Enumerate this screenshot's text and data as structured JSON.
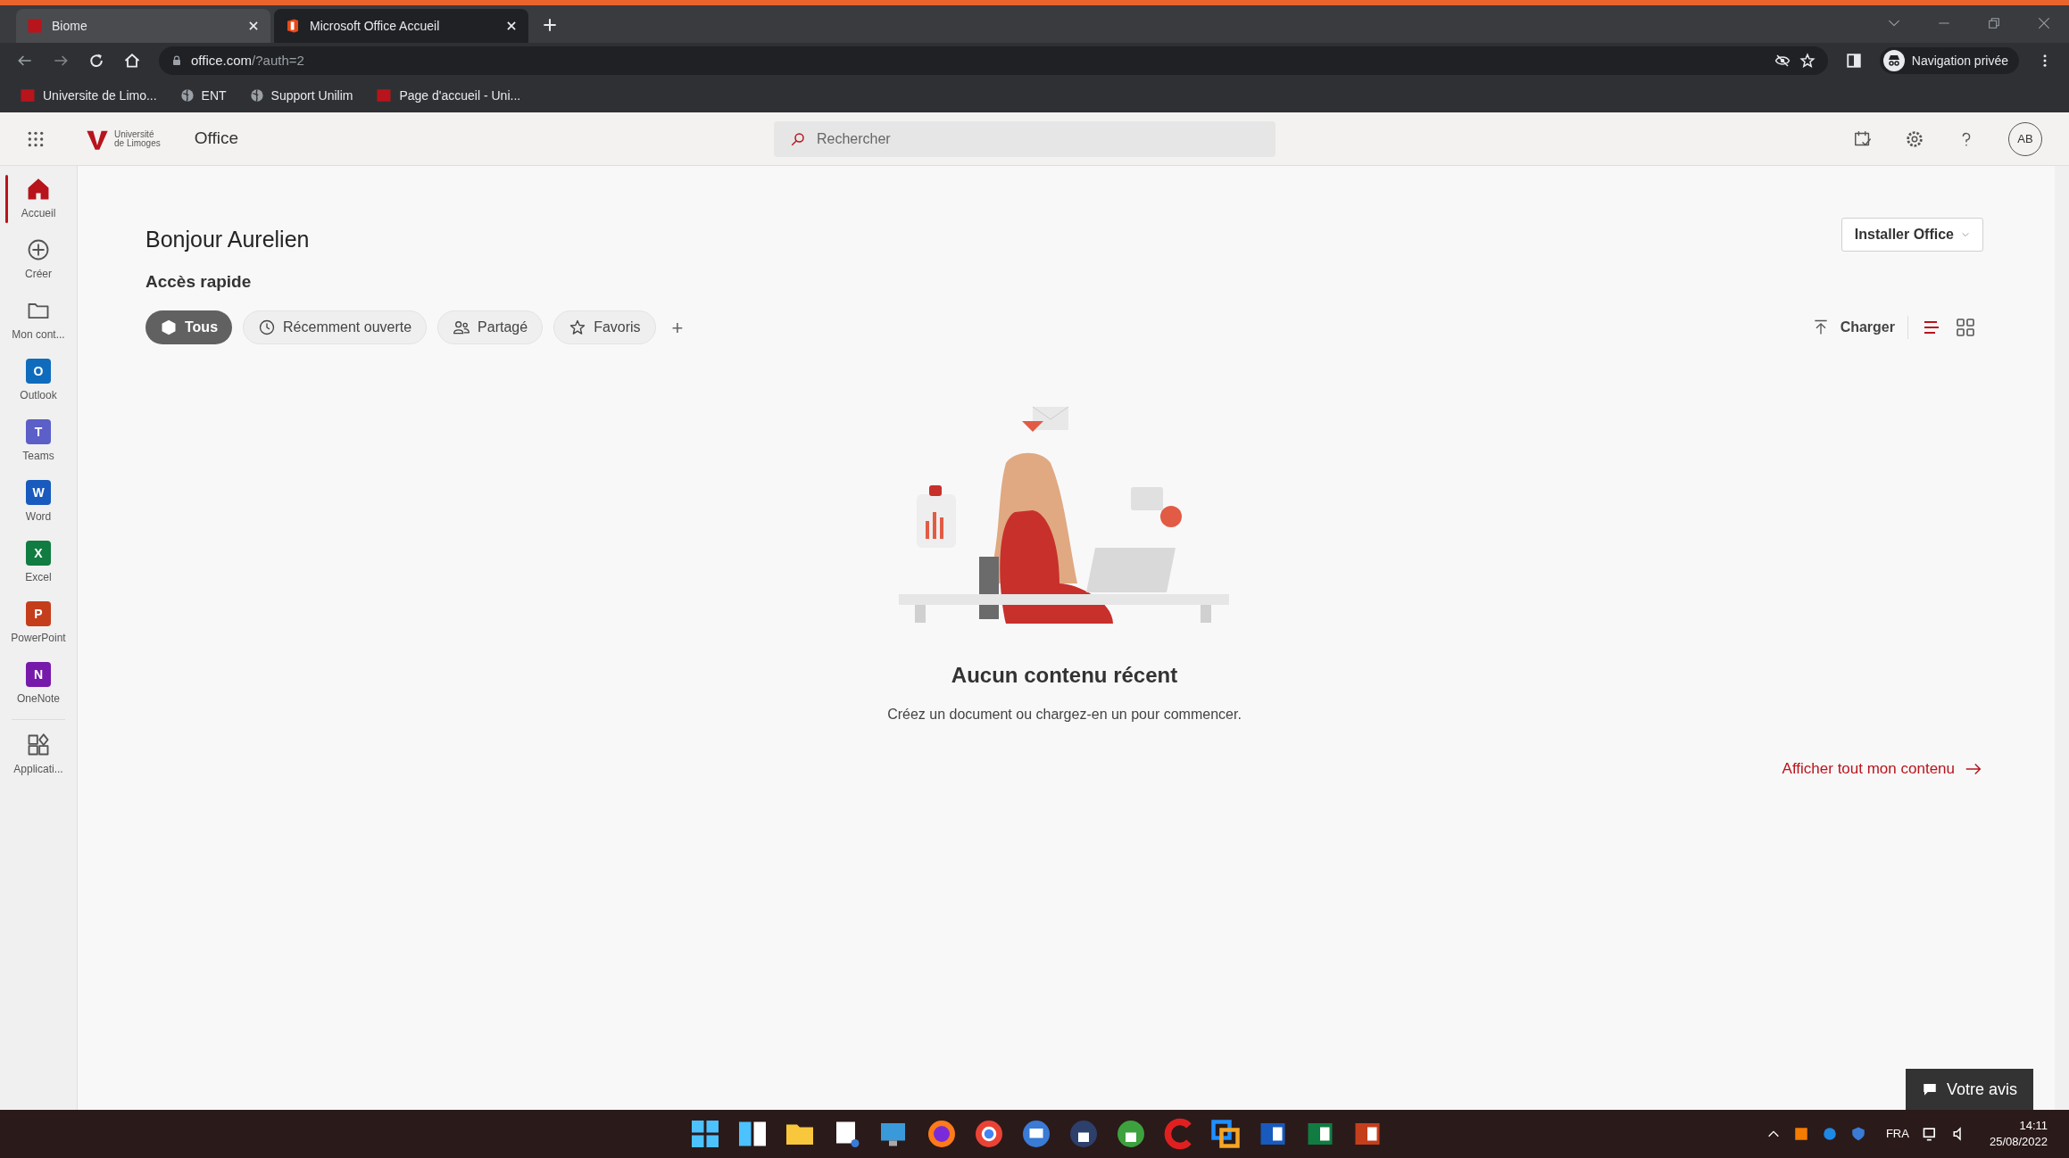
{
  "browser": {
    "tabs": [
      {
        "title": "Biome",
        "selected": false
      },
      {
        "title": "Microsoft Office Accueil",
        "selected": true
      }
    ],
    "url": {
      "host": "office.com",
      "path": "/?auth=2"
    },
    "profile": "Navigation privée",
    "bookmarks": [
      {
        "label": "Universite de Limo...",
        "kind": "unilim"
      },
      {
        "label": "ENT",
        "kind": "globe"
      },
      {
        "label": "Support Unilim",
        "kind": "globe"
      },
      {
        "label": "Page d'accueil - Uni...",
        "kind": "unilim"
      }
    ]
  },
  "header": {
    "logo_line_1": "Université",
    "logo_line_2": "de Limoges",
    "app_name": "Office",
    "search": {
      "placeholder": "Rechercher"
    },
    "avatar": "AB"
  },
  "sidebar": {
    "items": [
      {
        "label": "Accueil",
        "kind": "home",
        "selected": true
      },
      {
        "label": "Créer",
        "kind": "create",
        "selected": false
      },
      {
        "label": "Mon cont...",
        "kind": "folder",
        "selected": false
      },
      {
        "label": "Outlook",
        "kind": "app",
        "letter": "O",
        "color": "#0f6cbd",
        "selected": false
      },
      {
        "label": "Teams",
        "kind": "app",
        "letter": "T",
        "color": "#5b5fc7",
        "selected": false
      },
      {
        "label": "Word",
        "kind": "app",
        "letter": "W",
        "color": "#185abd",
        "selected": false
      },
      {
        "label": "Excel",
        "kind": "app",
        "letter": "X",
        "color": "#107c41",
        "selected": false
      },
      {
        "label": "PowerPoint",
        "kind": "app",
        "letter": "P",
        "color": "#c43e1c",
        "selected": false
      },
      {
        "label": "OneNote",
        "kind": "app",
        "letter": "N",
        "color": "#7719aa",
        "selected": false
      },
      {
        "label": "Applicati...",
        "kind": "apps",
        "selected": false
      }
    ]
  },
  "main": {
    "greeting": "Bonjour Aurelien",
    "install_button": "Installer Office",
    "quick_access_title": "Accès rapide",
    "filters": [
      {
        "label": "Tous",
        "kind": "all",
        "selected": true
      },
      {
        "label": "Récemment ouverte",
        "kind": "recent",
        "selected": false
      },
      {
        "label": "Partagé",
        "kind": "shared",
        "selected": false
      },
      {
        "label": "Favoris",
        "kind": "favorites",
        "selected": false
      }
    ],
    "add_filter": "+",
    "upload_button": "Charger",
    "views": [
      {
        "kind": "list",
        "selected": true
      },
      {
        "kind": "grid",
        "selected": false
      }
    ],
    "empty_title": "Aucun contenu récent",
    "empty_text": "Créez un document ou chargez-en un pour commencer.",
    "view_all_link": "Afficher tout mon contenu",
    "feedback_button": "Votre avis"
  },
  "taskbar": {
    "language": "FRA",
    "time": "14:11",
    "date": "25/08/2022"
  }
}
